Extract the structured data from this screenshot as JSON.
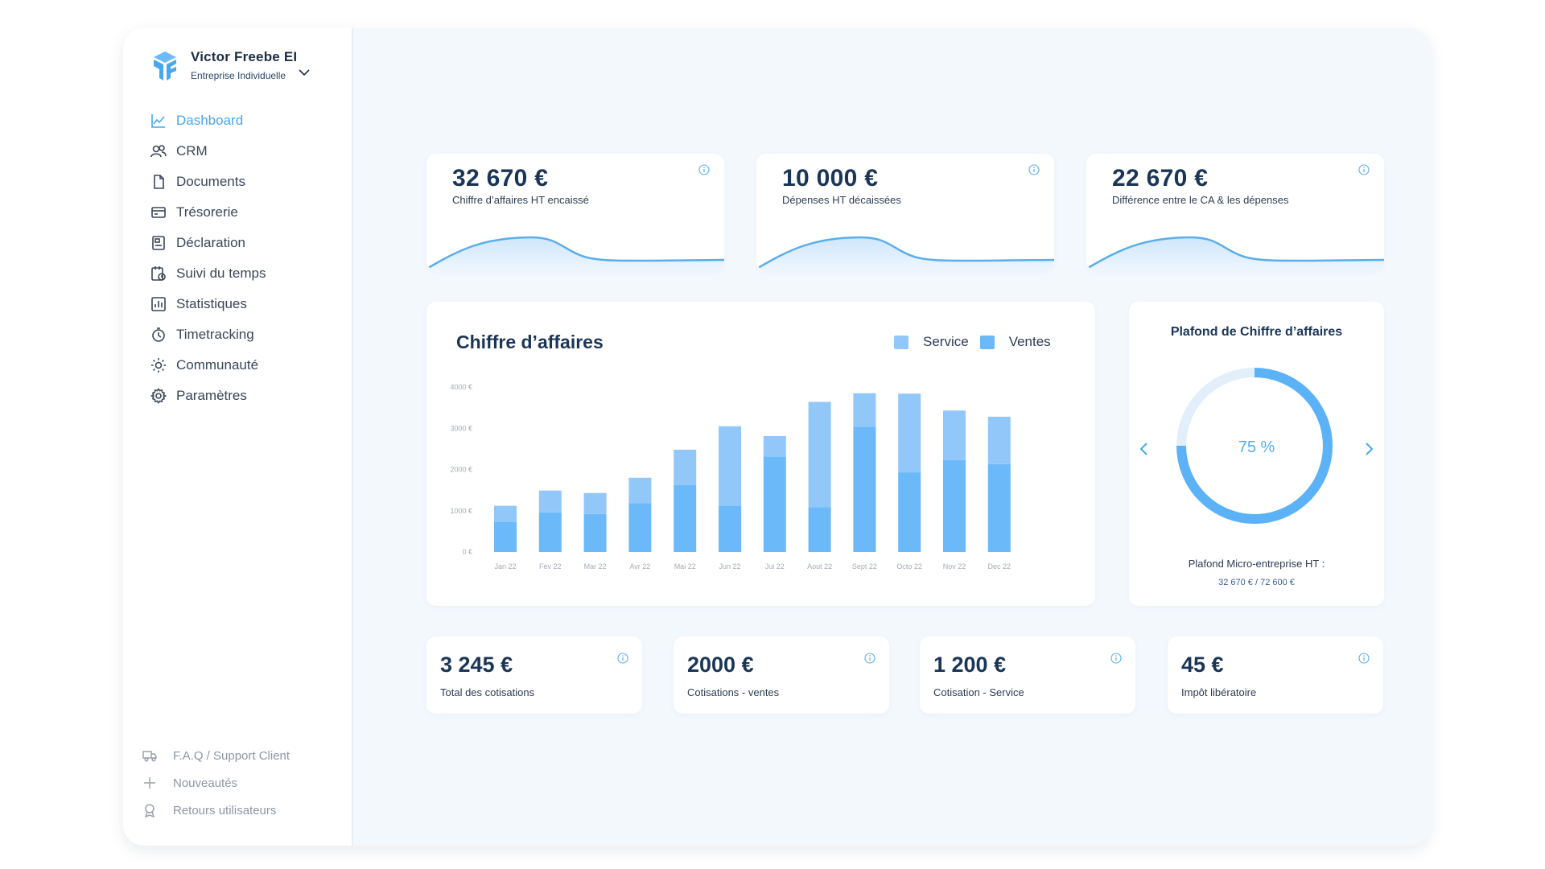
{
  "account": {
    "name": "Victor Freebe EI",
    "type": "Entreprise Individuelle"
  },
  "nav": [
    {
      "label": "Dashboard",
      "icon": "chart-line-icon",
      "active": true
    },
    {
      "label": "CRM",
      "icon": "users-icon"
    },
    {
      "label": "Documents",
      "icon": "file-icon"
    },
    {
      "label": "Trésorerie",
      "icon": "card-icon"
    },
    {
      "label": "Déclaration",
      "icon": "form-icon"
    },
    {
      "label": "Suivi du temps",
      "icon": "time-calendar-icon"
    },
    {
      "label": "Statistiques",
      "icon": "bar-chart-icon"
    },
    {
      "label": "Timetracking",
      "icon": "stopwatch-icon"
    },
    {
      "label": "Communauté",
      "icon": "sun-icon"
    },
    {
      "label": "Paramètres",
      "icon": "gear-icon"
    }
  ],
  "footer_nav": [
    {
      "label": "F.A.Q / Support Client",
      "icon": "truck-icon"
    },
    {
      "label": "Nouveautés",
      "icon": "plus-icon"
    },
    {
      "label": "Retours utilisateurs",
      "icon": "badge-icon"
    }
  ],
  "kpis": [
    {
      "value": "32 670 €",
      "label": "Chiffre d’affaires HT encaissé"
    },
    {
      "value": "10 000 €",
      "label": "Dépenses HT décaissées"
    },
    {
      "value": "22 670 €",
      "label": "Différence entre le CA & les dépenses"
    }
  ],
  "small_kpis": [
    {
      "value": "3 245 €",
      "label": "Total des cotisations"
    },
    {
      "value": "2000 €",
      "label": "Cotisations - ventes"
    },
    {
      "value": "1 200 €",
      "label": "Cotisation - Service"
    },
    {
      "value": "45 €",
      "label": "Impôt libératoire"
    }
  ],
  "gauge": {
    "title": "Plafond de Chiffre d’affaires",
    "percent_label": "75 %",
    "percent": 75,
    "subtitle": "Plafond Micro-entreprise HT :",
    "value": "32 670 € / 72 600 €"
  },
  "colors": {
    "accent": "#49a7ec",
    "service": "#92c8f9",
    "ventes": "#6bb9f8",
    "title": "#1a3556"
  },
  "chart_data": {
    "type": "bar",
    "stacked": true,
    "title": "Chiffre d’affaires",
    "categories": [
      "Jan 22",
      "Fév 22",
      "Mar 22",
      "Avr 22",
      "Mai 22",
      "Jun 22",
      "Jui 22",
      "Aout 22",
      "Sept 22",
      "Octo 22",
      "Nov 22",
      "Dec 22"
    ],
    "series": [
      {
        "name": "Ventes",
        "values": [
          730,
          960,
          920,
          1180,
          1620,
          1120,
          2310,
          1090,
          3040,
          1930,
          2230,
          2130
        ]
      },
      {
        "name": "Service",
        "values": [
          390,
          530,
          510,
          620,
          860,
          1930,
          500,
          2550,
          810,
          1910,
          1200,
          1150
        ]
      }
    ],
    "yticks": [
      "0 €",
      "1000 €",
      "2000 €",
      "3000 €",
      "4000 €"
    ],
    "ylim": [
      0,
      4000
    ],
    "legend": "top-right",
    "grid": false
  }
}
